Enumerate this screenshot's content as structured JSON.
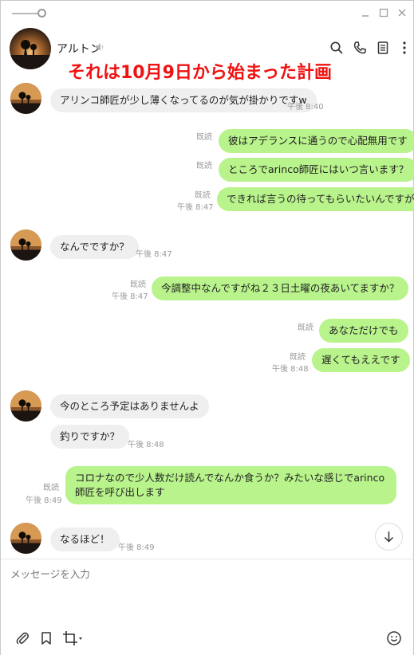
{
  "titlebar": {
    "minimize_icon": "minimize-icon",
    "maximize_icon": "maximize-icon",
    "close_icon": "close-icon"
  },
  "header": {
    "contact_name": "アルトン",
    "icons": [
      "search-icon",
      "phone-icon",
      "notes-icon",
      "menu-icon"
    ]
  },
  "overlay_caption": "それは10月9日から始まった計画",
  "messages": [
    {
      "side": "in",
      "text": "アリンコ師匠が少し薄くなってるのが気が掛かりですw",
      "time": "午後 8:40"
    },
    {
      "side": "out",
      "read": "既読",
      "text": "彼はアデランスに通うので心配無用です"
    },
    {
      "side": "out",
      "read": "既読",
      "text": "ところでarinco師匠にはいつ言います？"
    },
    {
      "side": "out",
      "read": "既読",
      "time": "午後 8:47",
      "text": "できれば言うの待ってもらいたいんですが"
    },
    {
      "side": "in",
      "text": "なんでですか？",
      "time": "午後 8:47"
    },
    {
      "side": "out",
      "read": "既読",
      "time": "午後 8:47",
      "text": "今調整中なんですがね２３日土曜の夜あいてますか？"
    },
    {
      "side": "out",
      "read": "既読",
      "text": "あなただけでも"
    },
    {
      "side": "out",
      "read": "既読",
      "time": "午後 8:48",
      "text": "遅くてもええです"
    },
    {
      "side": "in",
      "text": "今のところ予定はありませんよ"
    },
    {
      "side": "in",
      "text": "釣りですか？",
      "time": "午後 8:48"
    },
    {
      "side": "out",
      "read": "既読",
      "time": "午後 8:49",
      "text": "コロナなので少人数だけ読んでなんか食うか？みたいな感じでarinco師匠を呼び出します"
    },
    {
      "side": "in",
      "text": "なるほど！",
      "time": "午後 8:49"
    }
  ],
  "composer": {
    "placeholder": "メッセージを入力",
    "tools": [
      "attach-icon",
      "bookmark-icon",
      "crop-icon",
      "emoji-icon"
    ]
  },
  "colors": {
    "outgoing_bubble": "#b9f38c",
    "incoming_bubble": "#efefef",
    "caption": "#f01212"
  }
}
